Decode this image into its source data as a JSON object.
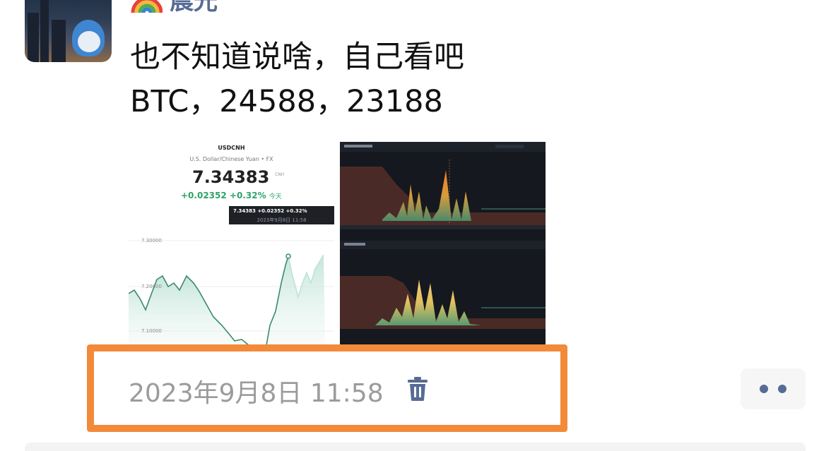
{
  "post": {
    "author": "晨光",
    "author_emoji_icon": "rainbow-icon",
    "text_lines": [
      "也不知道说啥，自己看吧",
      "BTC，24588，23188"
    ],
    "timestamp": "2023年9月8日 11:58"
  },
  "photos": [
    {
      "symbol": "USDCNH",
      "description": "U.S. Dollar/Chinese Yuan • FX",
      "price": "7.34383",
      "currency": "CNH",
      "change": "+0.02352",
      "change_pct": "+0.32%",
      "period": "今天",
      "tooltip_line1": "7.34383  +0.02352  +0.32%",
      "tooltip_line2": "2023年9月8日 11:58",
      "y_labels": [
        "7.30000",
        "7.20000",
        "7.10000"
      ]
    },
    {
      "type": "dark-dashboard-screenshot"
    }
  ],
  "actions": {
    "delete_icon": "trash-icon",
    "more_icon": "more-dots-icon"
  },
  "colors": {
    "link_blue": "#576b95",
    "highlight_orange": "#f28a3a",
    "timestamp_gray": "#9b9b9b",
    "up_green": "#2ea36b"
  }
}
